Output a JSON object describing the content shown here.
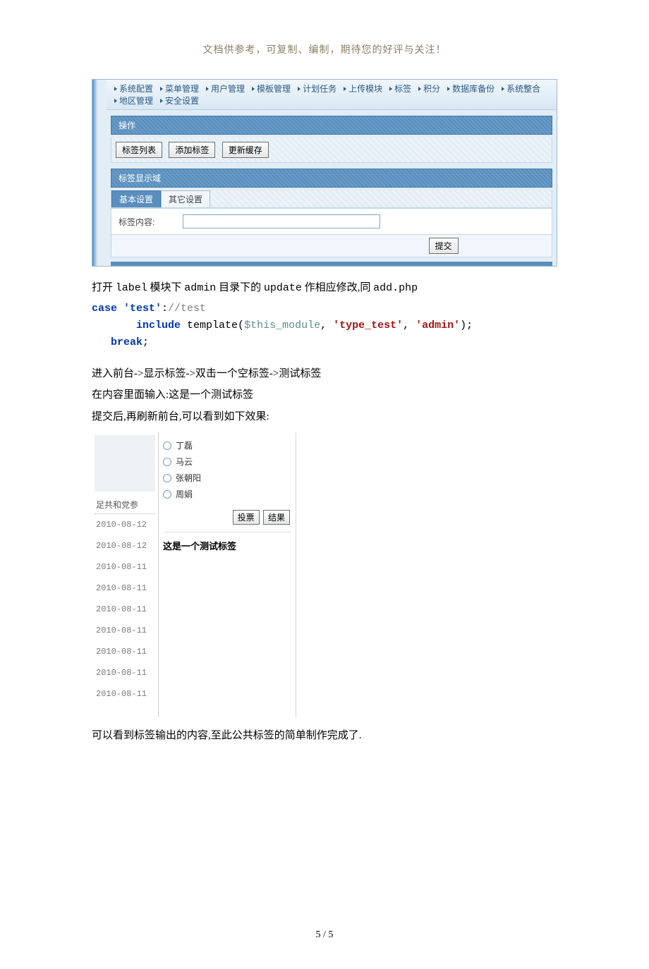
{
  "headerNote": "文档供参考，可复制、编制，期待您的好评与关注！",
  "admin": {
    "menu": [
      "系统配置",
      "菜单管理",
      "用户管理",
      "模板管理",
      "计划任务",
      "上传模块",
      "标签",
      "积分",
      "数据库备份",
      "系统整合",
      "地区管理",
      "安全设置"
    ],
    "opTitle": "操作",
    "opButtons": [
      "标签列表",
      "添加标签",
      "更新缓存"
    ],
    "dispTitle": "标签显示域",
    "tabs": {
      "active": "基本设置",
      "other": "其它设置"
    },
    "fieldLabel": "标签内容:",
    "submit": "提交"
  },
  "prose": {
    "p1_a": "打开 ",
    "p1_b": "label",
    "p1_c": " 模块下 ",
    "p1_d": "admin",
    "p1_e": " 目录下的 ",
    "p1_f": "update",
    "p1_g": " 作相应修改,同 ",
    "p1_h": "add.php"
  },
  "code": {
    "l1_kw": "case ",
    "l1_str": "'test'",
    "l1_colon": ":",
    "l1_cmt": "//test",
    "l2_indent": "       ",
    "l2_kw": "include",
    "l2_sp": " ",
    "l2_fn": "template(",
    "l2_var": "$this_module",
    "l2_c1": ", ",
    "l2_s1": "'type_test'",
    "l2_c2": ", ",
    "l2_s2": "'admin'",
    "l2_end": ");",
    "l3_indent": "   ",
    "l3_kw": "break",
    "l3_semi": ";"
  },
  "steps": {
    "p2": "进入前台->显示标签->双击一个空标签->测试标签",
    "p3": "在内容里面输入:这是一个测试标签",
    "p4": "提交后,再刷新前台,可以看到如下效果:"
  },
  "frontend": {
    "sideTitle": "足共和党参",
    "dates": [
      "2010-08-12",
      "2010-08-12",
      "2010-08-11",
      "2010-08-11",
      "2010-08-11",
      "2010-08-11",
      "2010-08-11",
      "2010-08-11",
      "2010-08-11"
    ],
    "radios": [
      "丁磊",
      "马云",
      "张朝阳",
      "周娟"
    ],
    "voteBtn": "投票",
    "resultBtn": "结果",
    "outputText": "这是一个测试标签"
  },
  "conclusion": "可以看到标签输出的内容,至此公共标签的简单制作完成了.",
  "pageNumber": "5 / 5"
}
